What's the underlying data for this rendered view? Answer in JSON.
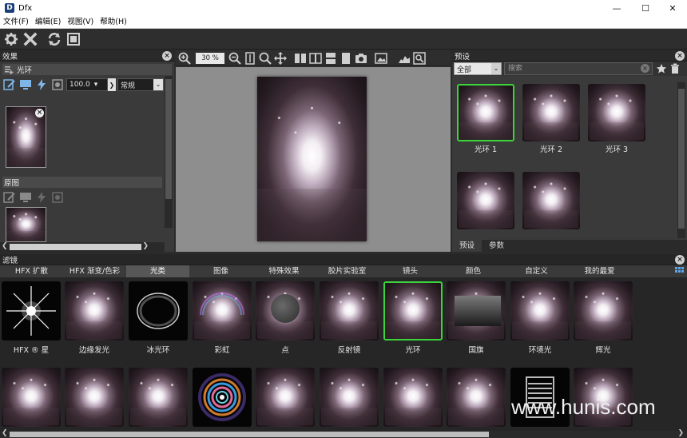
{
  "window": {
    "title": "Dfx",
    "app_icon": "Dfx-icon",
    "minimize": "—",
    "maximize": "☐",
    "close": "✕"
  },
  "menu": [
    "文件(F)",
    "编辑(E)",
    "视图(V)",
    "帮助(H)"
  ],
  "effects_panel": {
    "title": "效果",
    "effect_name": "光环",
    "opacity": "100.0",
    "blend_mode": "常规",
    "original_title": "原图"
  },
  "preview": {
    "zoom": "30 %"
  },
  "presets_panel": {
    "title": "预设",
    "category": "全部",
    "search_placeholder": "搜索",
    "items": [
      {
        "label": "光环 1",
        "selected": true
      },
      {
        "label": "光环 2",
        "selected": false
      },
      {
        "label": "光环 3",
        "selected": false
      },
      {
        "label": "",
        "selected": false
      },
      {
        "label": "",
        "selected": false
      }
    ],
    "tabs": [
      "预设",
      "参数"
    ]
  },
  "filters_panel": {
    "title": "滤镜",
    "tabs": [
      "HFX 扩散",
      "HFX 渐变/色彩",
      "光类",
      "图像",
      "特殊效果",
      "胶片实验室",
      "镜头",
      "颜色",
      "自定义",
      "我的最爱"
    ],
    "active_tab": 2,
    "row1": [
      {
        "label": "HFX ® 星",
        "kind": "star"
      },
      {
        "label": "边缘发光",
        "kind": "photo"
      },
      {
        "label": "冰光环",
        "kind": "ring"
      },
      {
        "label": "彩虹",
        "kind": "photo"
      },
      {
        "label": "点",
        "kind": "dot"
      },
      {
        "label": "反射镜",
        "kind": "photo"
      },
      {
        "label": "光环",
        "kind": "photo",
        "selected": true
      },
      {
        "label": "国旗",
        "kind": "flag"
      },
      {
        "label": "环境光",
        "kind": "photo"
      },
      {
        "label": "辉光",
        "kind": "photo"
      }
    ],
    "row2_kinds": [
      "photo",
      "photo",
      "photo",
      "rainbow-ring",
      "photo",
      "photo",
      "photo",
      "photo",
      "stripes",
      "photo"
    ]
  },
  "watermark": "www.hunis.com"
}
